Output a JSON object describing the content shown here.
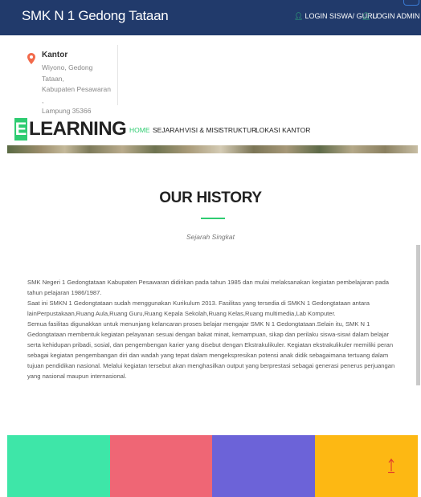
{
  "header": {
    "brand": "SMK N 1 Gedong Tataan",
    "login_siswa": "LOGIN SISWA/ GURU",
    "login_admin": "LOGIN ADMIN",
    "accent_color": "#213a6b"
  },
  "office": {
    "icon": "map-pin-icon",
    "title": "Kantor",
    "address_lines": [
      "Wiyono, Gedong Tataan,",
      "Kabupaten Pesawaran ,",
      "Lampung 35366"
    ]
  },
  "logo": {
    "e": "E",
    "rest": "LEARNING"
  },
  "nav": [
    "HOME",
    "SEJARAH",
    "VISI & MISI",
    "STRUKTUR",
    "LOKASI KANTOR"
  ],
  "nav_active": "HOME",
  "section": {
    "title": "OUR HISTORY",
    "subtitle": "Sejarah Singkat"
  },
  "history_paragraphs": [
    "SMK Negeri 1 Gedongtataan Kabupaten Pesawaran didirikan pada tahun 1985 dan mulai melaksanakan kegiatan pembelajaran pada tahun pelajaran 1986/1987.",
    "Saat ini SMKN 1 Gedongtataan sudah menggunakan Kurikulum 2013. Fasilitas yang tersedia di SMKN 1 Gedongtataan antara lainPerpustakaan,Ruang Aula,Ruang Guru,Ruang Kepala Sekolah,Ruang Kelas,Ruang multimedia,Lab Komputer.",
    "Semua fasilitas digunakkan untuk menunjang kelancaran proses belajar mengajar SMK N 1 Gedongtataan.Selain itu, SMK N 1 Gedongtataan membentuk kegiatan pelayanan sesuai dengan bakat minat, kemampuan, sikap dan perilaku siswa-siswi dalam belajar serta kehidupan pribadi, sosial, dan pengembengan karier yang disebut dengan Ekstrakulikuler. Kegiatan ekstrakulikuler memiliki peran sebagai kegiatan pengembangan diri dan wadah yang tepat dalam mengekspresikan potensi anak didik sebagaimana tertuang dalam tujuan pendidikan nasional. Melalui kegiatan tersebut akan menghasilkan output yang berprestasi sebagai generasi penerus perjuangan yang nasional maupun internasional."
  ],
  "footer_colors": [
    "#3ee6a8",
    "#ef6675",
    "#6c63d8",
    "#fdb813"
  ],
  "icons": {
    "login": "user-icon",
    "scroll_top": "arrow-up-icon"
  }
}
